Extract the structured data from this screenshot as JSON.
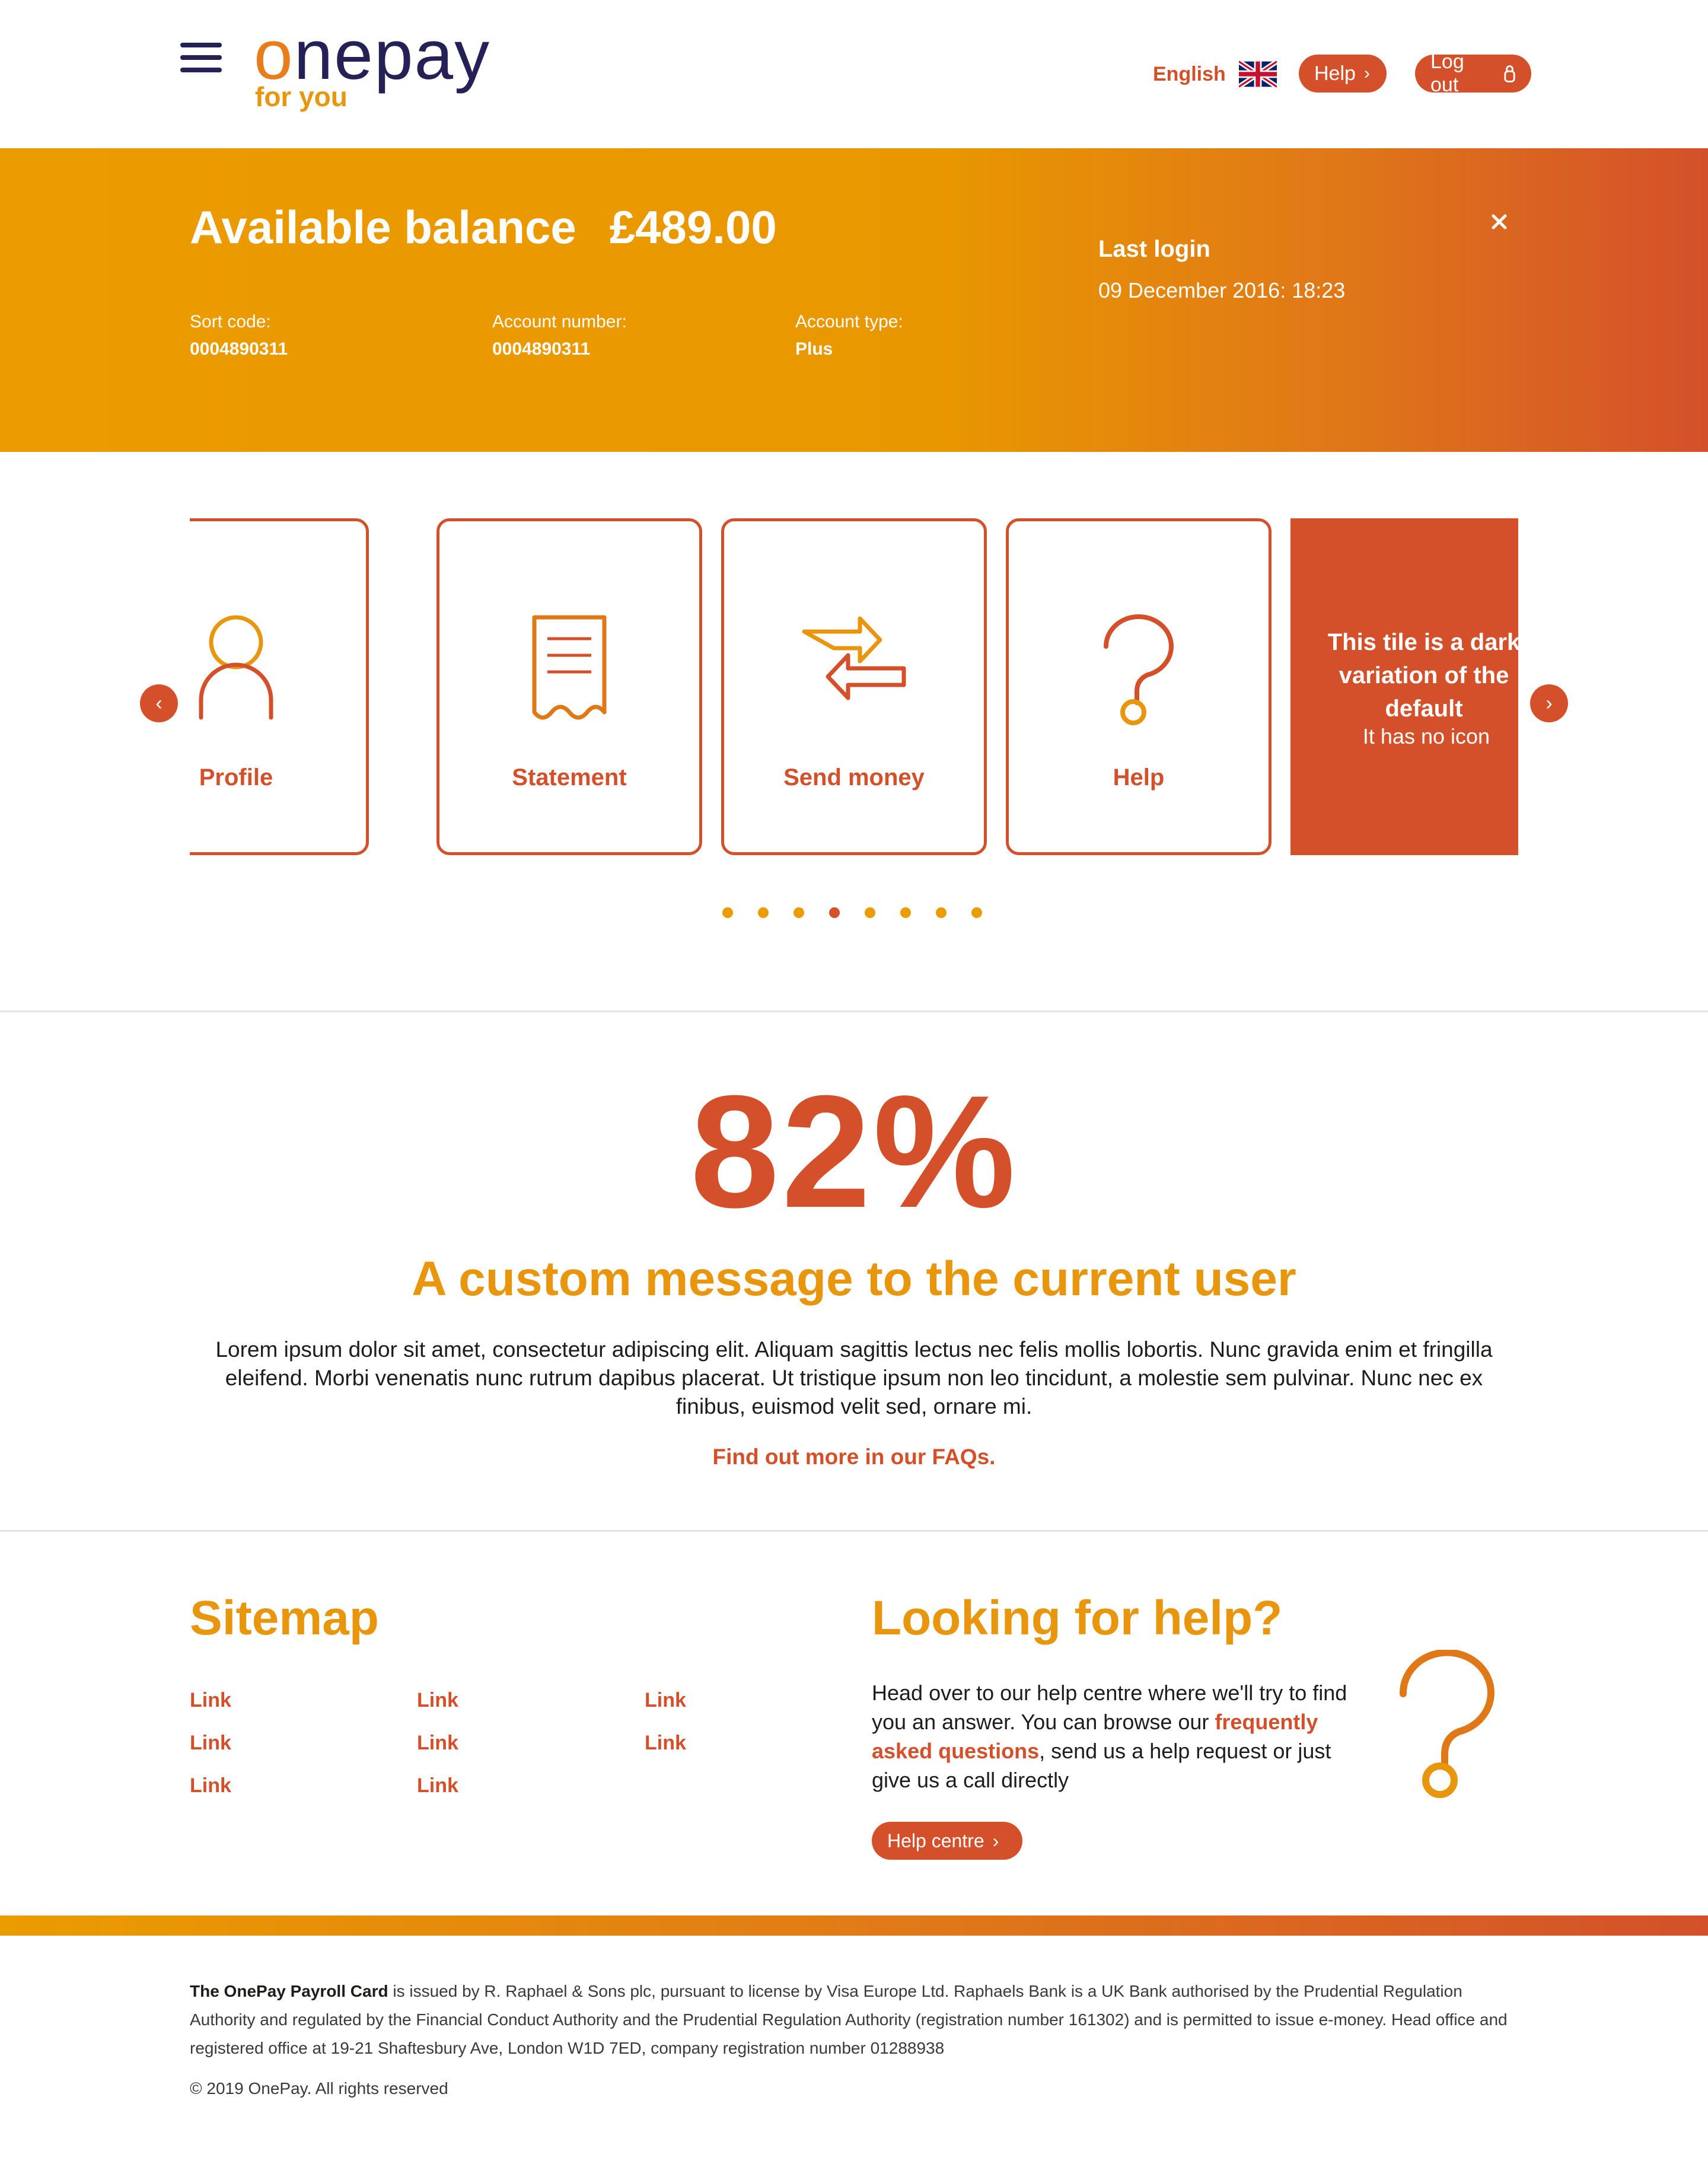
{
  "header": {
    "logo_word_first": "o",
    "logo_word_rest": "nepay",
    "logo_sub": "for you",
    "language": "English",
    "help_label": "Help",
    "logout_label": "Log out"
  },
  "balance": {
    "title": "Available balance",
    "amount": "£489.00",
    "sort_code_label": "Sort code:",
    "sort_code": "0004890311",
    "account_number_label": "Account number:",
    "account_number": "0004890311",
    "account_type_label": "Account type:",
    "account_type": "Plus",
    "last_login_label": "Last login",
    "last_login_value": "09 December 2016: 18:23"
  },
  "tiles": [
    {
      "label": "Profile",
      "icon": "user-icon"
    },
    {
      "label": "Statement",
      "icon": "receipt-icon"
    },
    {
      "label": "Send money",
      "icon": "transfer-icon"
    },
    {
      "label": "Help",
      "icon": "question-icon"
    }
  ],
  "dark_tile": {
    "title": "This tile is a dark variation of the default",
    "subtitle": "It has no icon"
  },
  "carousel": {
    "dot_count": 8,
    "active_dot": 4
  },
  "stats": {
    "value": "82%",
    "headline": "A custom message to the current user",
    "body": "Lorem ipsum dolor sit amet, consectetur adipiscing elit. Aliquam sagittis lectus nec felis mollis lobortis. Nunc gravida enim et fringilla eleifend. Morbi venenatis nunc rutrum dapibus placerat. Ut tristique ipsum non leo tincidunt, a molestie sem pulvinar. Nunc nec ex finibus, euismod velit sed, ornare mi.",
    "link": "Find out more in our FAQs."
  },
  "sitemap": {
    "title": "Sitemap",
    "links": [
      "Link",
      "Link",
      "Link",
      "Link",
      "Link",
      "Link",
      "Link",
      "Link"
    ]
  },
  "help_section": {
    "title": "Looking for help?",
    "text_before": "Head over to our help centre where we'll try to find you an answer. You can browse our ",
    "faq_link": "frequently asked questions",
    "text_after": ", send us a help request or just give us a call directly",
    "button": "Help centre"
  },
  "footer": {
    "legal_strong": "The OnePay Payroll Card",
    "legal_text": " is issued by R. Raphael & Sons plc, pursuant to license by Visa Europe Ltd. Raphaels Bank is a UK Bank authorised by the Prudential Regulation Authority and regulated by the Financial Conduct Authority and the Prudential Regulation Authority (registration number 161302) and is permitted to issue e-money. Head office and registered office at 19-21 Shaftesbury Ave, London W1D 7ED, company registration number 01288938",
    "copyright": "© 2019 OnePay. All rights reserved"
  },
  "colors": {
    "primary": "#d4502a",
    "accent": "#eb9c00",
    "navy": "#242157"
  }
}
